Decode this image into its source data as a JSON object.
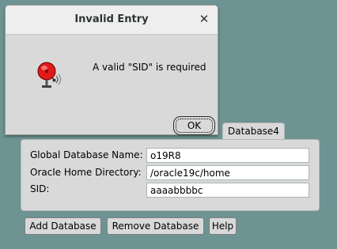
{
  "dialog": {
    "title": "Invalid Entry",
    "close_glyph": "✕",
    "message": "A valid \"SID\" is required",
    "icon": "bell-icon",
    "ok_label": "OK"
  },
  "panel": {
    "tab_label": "Database4",
    "fields": {
      "global_db_name": {
        "label": "Global Database Name:",
        "value": "o19R8"
      },
      "oracle_home": {
        "label": "Oracle Home Directory:",
        "value": "/oracle19c/home"
      },
      "sid": {
        "label": "SID:",
        "value": "aaaabbbbc"
      }
    }
  },
  "buttons": {
    "add_database": "Add Database",
    "remove_database": "Remove Database",
    "help": "Help"
  },
  "colors": {
    "desktop": "#6e9393",
    "panel": "#d9d9d9",
    "bell_red": "#e01a1a"
  }
}
